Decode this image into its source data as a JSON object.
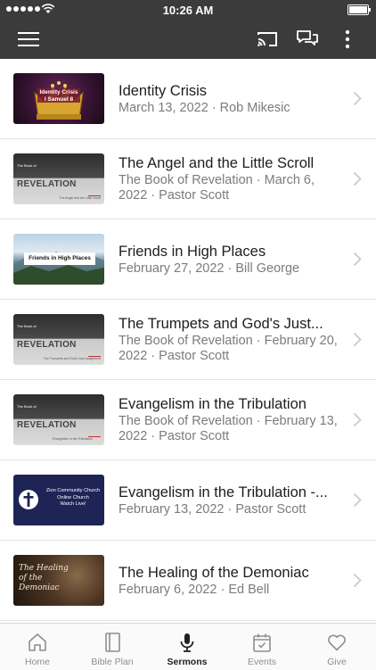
{
  "status": {
    "time": "10:26 AM"
  },
  "app_bar": {
    "icons": [
      "menu-icon",
      "cast-icon",
      "chat-icon",
      "more-vertical-icon"
    ]
  },
  "sermons": [
    {
      "title": "Identity Crisis",
      "subtitle": "March 13, 2022 · Rob Mikesic",
      "thumb": {
        "kind": "crown",
        "text": "Identity Crisis\nI Samuel 8"
      }
    },
    {
      "title": "The Angel and the Little Scroll",
      "subtitle": "The Book of Revelation · March 6, 2022 · Pastor Scott",
      "thumb": {
        "kind": "revelation",
        "text": "REVELATION",
        "small": "The Book of",
        "caption": "The Angel and the Little Scroll"
      }
    },
    {
      "title": "Friends in High Places",
      "subtitle": "February 27, 2022 · Bill George",
      "thumb": {
        "kind": "mountains",
        "text": "Friends in High Places"
      }
    },
    {
      "title": "The Trumpets and God's Just...",
      "subtitle": "The Book of Revelation · February 20, 2022 · Pastor Scott",
      "thumb": {
        "kind": "revelation",
        "text": "REVELATION",
        "small": "The Book of",
        "caption": "The Trumpets and God's Just Judgement"
      }
    },
    {
      "title": "Evangelism in the Tribulation",
      "subtitle": "The Book of Revelation · February 13, 2022 · Pastor Scott",
      "thumb": {
        "kind": "revelation",
        "text": "REVELATION",
        "small": "The Book of",
        "caption": "Evangelism in the Tribulation"
      }
    },
    {
      "title": "Evangelism in the Tribulation -...",
      "subtitle": "February 13, 2022 · Pastor Scott",
      "thumb": {
        "kind": "church",
        "text": "Zion Community Church\nOnline Church\nWatch Live!"
      }
    },
    {
      "title": "The Healing of the Demoniac",
      "subtitle": "February 6, 2022 · Ed Bell",
      "thumb": {
        "kind": "healing",
        "text": "The Healing of the Demoniac"
      }
    }
  ],
  "tabs": [
    {
      "label": "Home",
      "icon": "home-icon",
      "active": false
    },
    {
      "label": "Bible Plan",
      "icon": "book-icon",
      "active": false
    },
    {
      "label": "Sermons",
      "icon": "microphone-icon",
      "active": true
    },
    {
      "label": "Events",
      "icon": "calendar-icon",
      "active": false
    },
    {
      "label": "Give",
      "icon": "heart-icon",
      "active": false
    }
  ],
  "colors": {
    "bar": "#3b3b3b",
    "text": "#1d1d1d",
    "muted": "#7b7b7b",
    "divider": "#e3e3e3"
  }
}
